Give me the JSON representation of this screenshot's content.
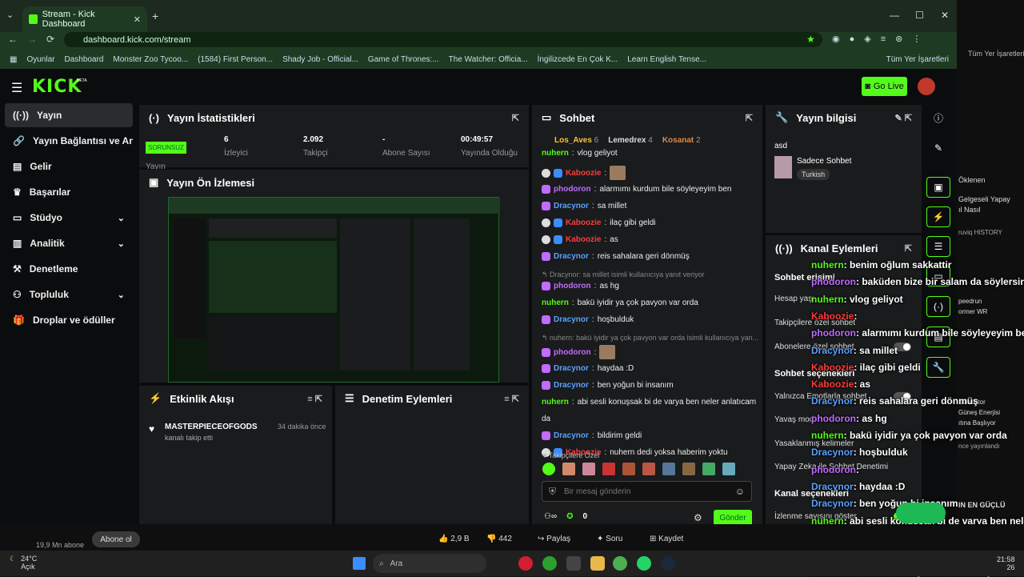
{
  "browser": {
    "tab_title": "Stream - Kick Dashboard",
    "url": "dashboard.kick.com/stream",
    "bookmarks": [
      "Oyunlar",
      "Dashboard",
      "Monster Zoo Tycoo...",
      "(1584) First Person...",
      "Shady Job - Official...",
      "Game of Thrones:...",
      "The Watcher: Officia...",
      "İngilizcede En Çok K...",
      "Learn English Tense..."
    ],
    "all_bookmarks": "Tüm Yer İşaretleri"
  },
  "app": {
    "logo": "KICK",
    "beta": "BETA",
    "go_live": "Go Live"
  },
  "sidebar": {
    "items": [
      {
        "label": "Yayın",
        "icon": "broadcast-icon"
      },
      {
        "label": "Yayın Bağlantısı ve Anahtarı",
        "icon": "link-icon"
      },
      {
        "label": "Gelir",
        "icon": "chart-icon"
      },
      {
        "label": "Başarılar",
        "icon": "trophy-icon"
      },
      {
        "label": "Stüdyo",
        "icon": "studio-icon"
      },
      {
        "label": "Analitik",
        "icon": "analytics-icon"
      },
      {
        "label": "Denetleme",
        "icon": "hammer-icon"
      },
      {
        "label": "Topluluk",
        "icon": "community-icon"
      },
      {
        "label": "Droplar ve ödüller",
        "icon": "gift-icon"
      }
    ]
  },
  "stats": {
    "title": "Yayın İstatistikleri",
    "status": "SORUNSUZ",
    "status_label": "Yayın",
    "cells": [
      {
        "value": "6",
        "label": "İzleyici"
      },
      {
        "value": "2.092",
        "label": "Takipçi"
      },
      {
        "value": "-",
        "label": "Abone Sayısı"
      },
      {
        "value": "00:49:57",
        "label": "Yayında Olduğu"
      }
    ]
  },
  "preview": {
    "title": "Yayın Ön İzlemesi"
  },
  "activity": {
    "title": "Etkinlik Akışı",
    "user": "MASTERPIECEOFGODS",
    "action": "kanalı takip etti",
    "time": "34 dakika önce"
  },
  "mod_actions": {
    "title": "Denetim Eylemleri"
  },
  "chat": {
    "title": "Sohbet",
    "top": [
      {
        "name": "Los_Aves",
        "count": "6"
      },
      {
        "name": "Lemedrex",
        "count": "4"
      },
      {
        "name": "Kosanat",
        "count": "2"
      }
    ],
    "messages": [
      {
        "user": "nuhern",
        "text": "vlog geliyot",
        "c": "nu",
        "b": ""
      },
      {
        "user": "Kaboozie",
        "text": "",
        "c": "ka",
        "b": "wb",
        "img": true
      },
      {
        "user": "phodoron",
        "text": "alarmımı kurdum bile söyleyeyim ben",
        "c": "ph",
        "b": "p"
      },
      {
        "user": "Dracynor",
        "text": "sa millet",
        "c": "dr",
        "b": "p"
      },
      {
        "user": "Kaboozie",
        "text": "ilaç gibi geldi",
        "c": "ka",
        "b": "wb"
      },
      {
        "user": "Kaboozie",
        "text": "as",
        "c": "ka",
        "b": "wb"
      },
      {
        "user": "Dracynor",
        "text": "reis sahalara geri dönmüş",
        "c": "dr",
        "b": "p"
      },
      {
        "sys": "↰ Dracynor: sa millet isimli kullanıcıya yanıt veriyor"
      },
      {
        "user": "phodoron",
        "text": "as hg",
        "c": "ph",
        "b": "p"
      },
      {
        "user": "nuhern",
        "text": "bakü iyidir ya çok pavyon var orda",
        "c": "nu",
        "b": ""
      },
      {
        "user": "Dracynor",
        "text": "hoşbulduk",
        "c": "dr",
        "b": "p"
      },
      {
        "sys": "↰ nuhern: bakü iyidir ya çok pavyon var orda isimli kullanıcıya yan..."
      },
      {
        "user": "phodoron",
        "text": "",
        "c": "ph",
        "b": "p",
        "img": true
      },
      {
        "user": "Dracynor",
        "text": "haydaa :D",
        "c": "dr",
        "b": "p"
      },
      {
        "user": "Dracynor",
        "text": "ben yoğun bi insanım",
        "c": "dr",
        "b": "p"
      },
      {
        "user": "nuhern",
        "text": "abi sesli konuşsak bi de varya ben neler anlatıcam",
        "c": "nu",
        "b": ""
      },
      {
        "cont": "da"
      },
      {
        "user": "Dracynor",
        "text": "bildirim geldi",
        "c": "dr",
        "b": "p"
      },
      {
        "user": "Kaboozie",
        "text": "nuhern dedi yoksa haberim yoktu",
        "c": "ka",
        "b": "wb"
      }
    ],
    "followers_label": "Takipçilere Özel",
    "placeholder": "Bir mesaj gönderin",
    "points": "0",
    "send": "Gönder"
  },
  "info": {
    "title": "Yayın bilgisi",
    "stream_title": "asd",
    "category": "Sadece Sohbet",
    "tag": "Turkish"
  },
  "channel": {
    "title": "Kanal Eylemleri",
    "sec1": "Sohbet erişimi",
    "hesap": "Hesap yaşı",
    "takip": "Takipçilere özel sohbet",
    "abone": "Abonelere özel sohbet",
    "sec2": "Sohbet seçenekleri",
    "emote": "Yalnızca Emotlarla sohbet",
    "yavas": "Yavaş mod",
    "yasak": "Yasaklanmış kelimeler",
    "yapay": "Yapay Zeka ile Sohbet Denetimi",
    "sec3": "Kanal seçenekleri",
    "izleme": "İzlenme sayısını göster"
  },
  "overlay": [
    {
      "u": "nuhern",
      "t": ": benim oğlum sakkattir",
      "c": "nu"
    },
    {
      "u": "phodoron",
      "t": ": baküden bize bir salam da söylersin",
      "c": "ph"
    },
    {
      "u": "nuhern",
      "t": ": vlog geliyot",
      "c": "nu"
    },
    {
      "u": "Kaboozie",
      "t": ":",
      "c": "ka"
    },
    {
      "u": "phodoron",
      "t": ": alarmımı kurdum bile söyleyeyim ben",
      "c": "ph"
    },
    {
      "u": "Dracynor",
      "t": ": sa millet",
      "c": "dr"
    },
    {
      "u": "Kaboozie",
      "t": ": ilaç gibi geldi",
      "c": "ka"
    },
    {
      "u": "Kaboozie",
      "t": ": as",
      "c": "ka"
    },
    {
      "u": "Dracynor",
      "t": ": reis sahalara geri dönmüş",
      "c": "dr"
    },
    {
      "u": "phodoron",
      "t": ": as hg",
      "c": "ph"
    },
    {
      "u": "nuhern",
      "t": ": bakü iyidir ya çok pavyon var orda",
      "c": "nu"
    },
    {
      "u": "Dracynor",
      "t": ": hoşbulduk",
      "c": "dr"
    },
    {
      "u": "phodoron",
      "t": ":",
      "c": "ph"
    },
    {
      "u": "Dracynor",
      "t": ": haydaa :D",
      "c": "dr"
    },
    {
      "u": "Dracynor",
      "t": ": ben yoğun bi insanım",
      "c": "dr"
    },
    {
      "u": "nuhern",
      "t": ": abi sesli konuşsak bi de varya ben neler",
      "c": "nu"
    },
    {
      "u": "",
      "t": "anlatıcam da",
      "c": "nu"
    },
    {
      "u": "Dracynor",
      "t": ": bildirim geldi",
      "c": "dr"
    },
    {
      "u": "Kaboozie",
      "t": ": nuhern dedi yoksa haberim yoktu",
      "c": "ka"
    }
  ],
  "youtube": {
    "subs": "19,9 Mn abone",
    "subscribe": "Abone ol",
    "likes": "2,9 B",
    "dislikes": "442",
    "share": "Paylaş",
    "ask": "Soru",
    "save": "Kaydet",
    "right": [
      "Öklenen",
      "Gelgeseli Yapay",
      "ıl Nasıl",
      "ruviq HISTORY",
      "peedrun",
      "ormer WR",
      "Simulator",
      "Güneş Enerjisi",
      "ıtına Başlıyor",
      "nce yayınlandı",
      "IN EN GÜÇLÜ",
      "Tüm Yer İşaretleri"
    ]
  },
  "taskbar": {
    "temp": "24°C",
    "weather": "Açık",
    "search": "Ara",
    "time": "21:58",
    "date": "26"
  },
  "colors": {
    "accent": "#53fc18",
    "panel": "#191b1c"
  }
}
